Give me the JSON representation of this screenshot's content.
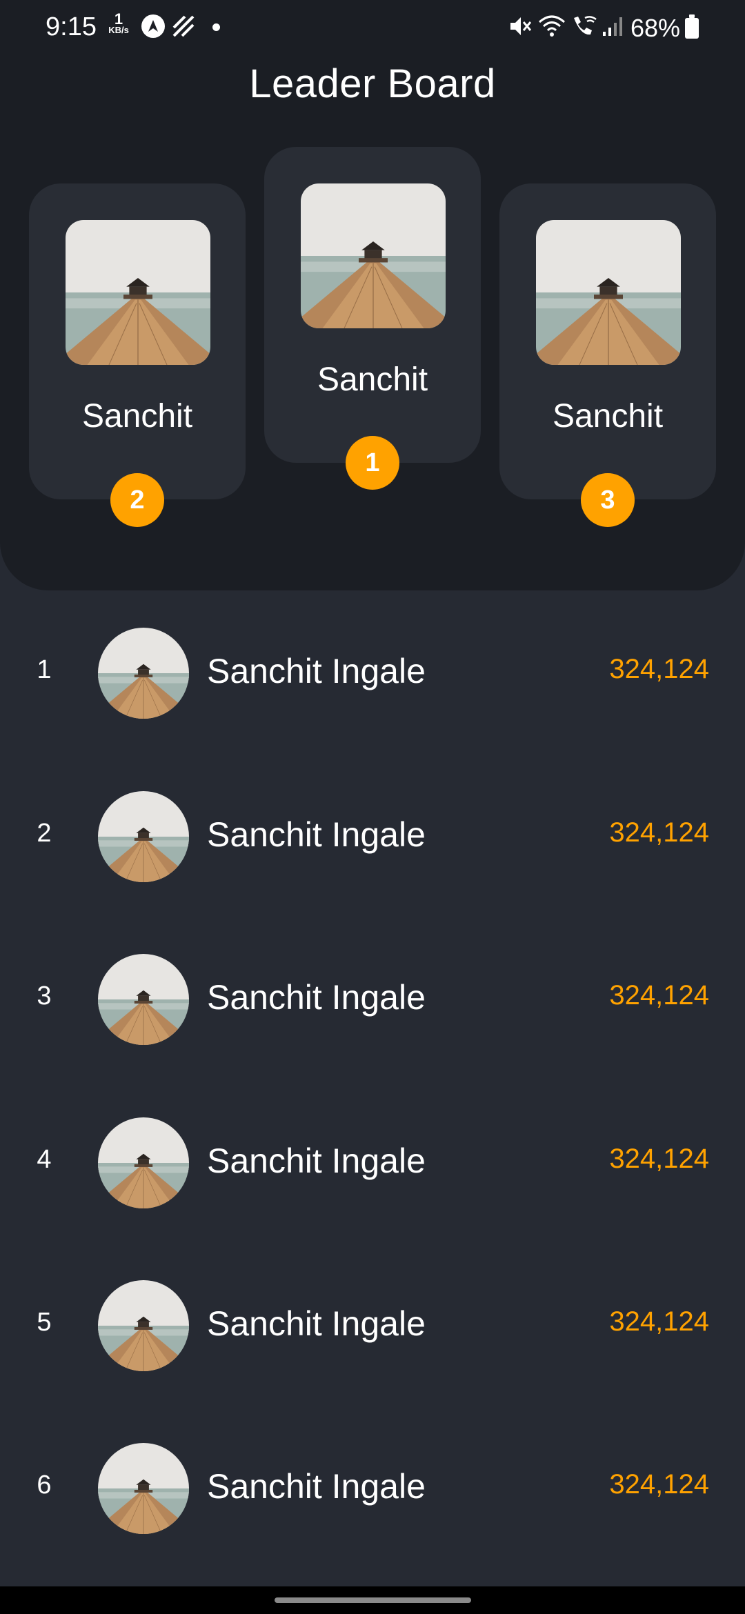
{
  "status_bar": {
    "time": "9:15",
    "net_speed_value": "1",
    "net_speed_unit": "KB/s",
    "battery_percent": "68%",
    "icons_left": [
      "nav-arrow-icon",
      "stripes-icon",
      "dot-icon"
    ],
    "icons_right": [
      "mute-icon",
      "wifi-icon",
      "wifi-call-icon",
      "signal-icon",
      "battery-icon"
    ]
  },
  "header": {
    "title": "Leader Board"
  },
  "podium": [
    {
      "place": "2",
      "name": "Sanchit"
    },
    {
      "place": "1",
      "name": "Sanchit"
    },
    {
      "place": "3",
      "name": "Sanchit"
    }
  ],
  "leaderboard": [
    {
      "rank": "1",
      "name": "Sanchit Ingale",
      "score": "324,124"
    },
    {
      "rank": "2",
      "name": "Sanchit Ingale",
      "score": "324,124"
    },
    {
      "rank": "3",
      "name": "Sanchit Ingale",
      "score": "324,124"
    },
    {
      "rank": "4",
      "name": "Sanchit Ingale",
      "score": "324,124"
    },
    {
      "rank": "5",
      "name": "Sanchit Ingale",
      "score": "324,124"
    },
    {
      "rank": "6",
      "name": "Sanchit Ingale",
      "score": "324,124"
    }
  ],
  "colors": {
    "background": "#262a33",
    "panel": "#1b1e24",
    "card": "#292d35",
    "accent": "#ffa200"
  }
}
